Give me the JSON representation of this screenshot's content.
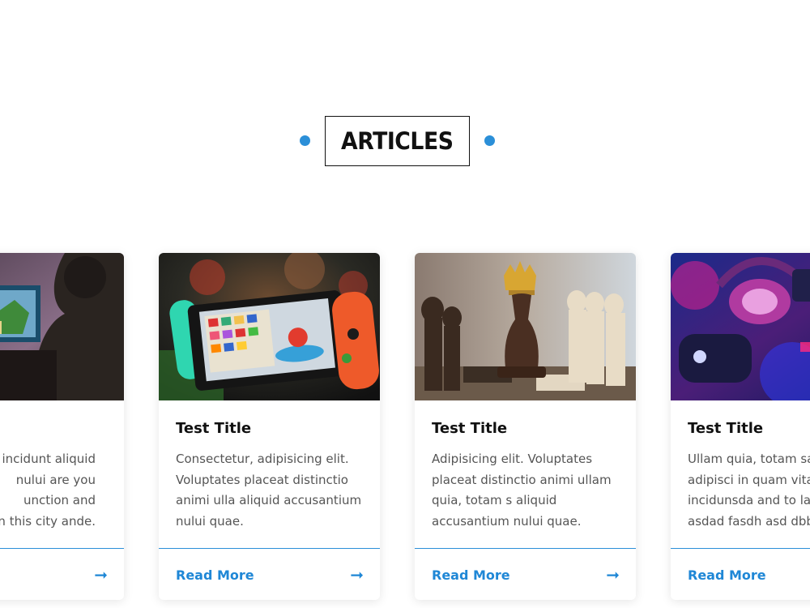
{
  "section": {
    "heading": "ARTICLES",
    "accent_color": "#2b8fd8"
  },
  "cards": [
    {
      "image": "gamer-at-pc-image",
      "title": "",
      "body_lines": [
        "incidunt aliquid",
        "nului are you",
        "unction and",
        "in this city ande."
      ],
      "read_more": "",
      "arrow": "➞"
    },
    {
      "image": "handheld-console-image",
      "title": "Test Title",
      "body_lines": [
        "Consectetur, adipisicing elit.",
        "Voluptates placeat distinctio",
        "animi ulla aliquid accusantium",
        "nului quae."
      ],
      "read_more": "Read More",
      "arrow": "➞"
    },
    {
      "image": "chess-pieces-image",
      "title": "Test Title",
      "body_lines": [
        "Adipisicing elit. Voluptates",
        "placeat distinctio animi ullam",
        "quia, totam s aliquid",
        "accusantium nului quae."
      ],
      "read_more": "Read More",
      "arrow": "➞"
    },
    {
      "image": "gaming-gear-image",
      "title": "Test Title",
      "body_lines": [
        "Ullam quia, totam sap",
        "adipisci in quam vitae",
        "incidunsda and to lad",
        "asdad fasdh asd dbbr"
      ],
      "read_more": "Read More",
      "arrow": "➞"
    }
  ]
}
